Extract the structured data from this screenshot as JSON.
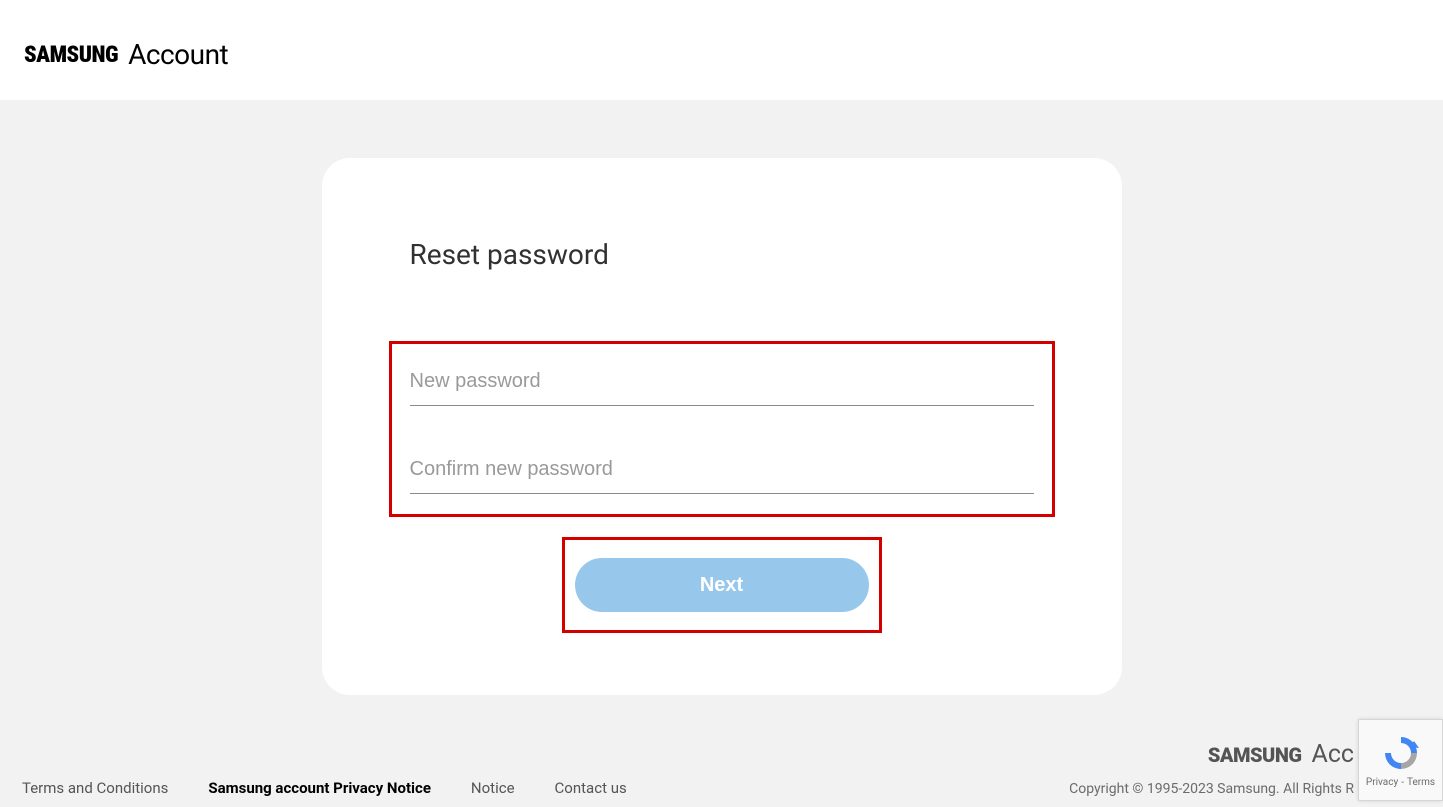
{
  "header": {
    "brand": "SAMSUNG",
    "product": "Account"
  },
  "card": {
    "title": "Reset password",
    "new_password_placeholder": "New password",
    "new_password_value": "",
    "confirm_password_placeholder": "Confirm new password",
    "confirm_password_value": "",
    "next_button_label": "Next"
  },
  "footer": {
    "links": {
      "terms": "Terms and Conditions",
      "privacy": "Samsung account Privacy Notice",
      "notice": "Notice",
      "contact": "Contact us"
    },
    "brand": "SAMSUNG",
    "product_partial": "Acc",
    "copyright": "Copyright © 1995-2023 Samsung. All Rights R"
  },
  "recaptcha": {
    "privacy": "Privacy",
    "separator": "-",
    "terms": "Terms"
  }
}
